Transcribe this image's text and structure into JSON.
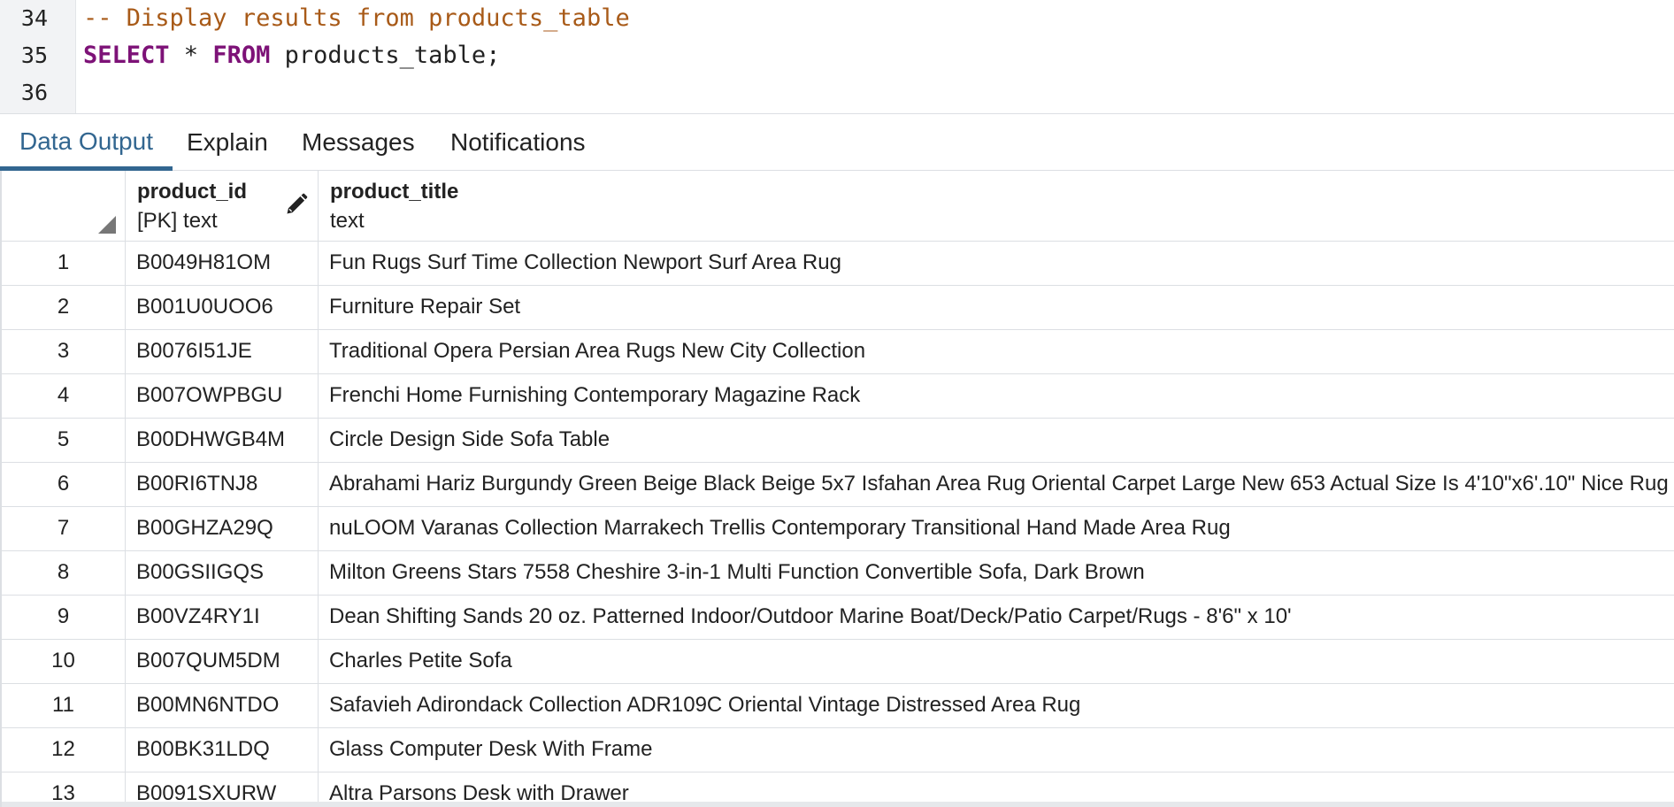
{
  "editor": {
    "lines": [
      {
        "number": "34",
        "tokens": [
          {
            "text": "-- Display results from products_table",
            "kind": "comment"
          }
        ]
      },
      {
        "number": "35",
        "tokens": [
          {
            "text": "SELECT",
            "kind": "keyword"
          },
          {
            "text": " * ",
            "kind": "plain"
          },
          {
            "text": "FROM",
            "kind": "keyword"
          },
          {
            "text": " products_table;",
            "kind": "plain"
          }
        ]
      },
      {
        "number": "36",
        "tokens": []
      }
    ]
  },
  "tabs": [
    {
      "label": "Data Output",
      "active": true
    },
    {
      "label": "Explain",
      "active": false
    },
    {
      "label": "Messages",
      "active": false
    },
    {
      "label": "Notifications",
      "active": false
    }
  ],
  "grid": {
    "columns": [
      {
        "name": "product_id",
        "type": "[PK] text",
        "icon": "pencil-icon"
      },
      {
        "name": "product_title",
        "type": "text"
      }
    ],
    "rows": [
      {
        "n": "1",
        "id": "B0049H81OM",
        "title": "Fun Rugs Surf Time Collection Newport Surf Area Rug"
      },
      {
        "n": "2",
        "id": "B001U0UOO6",
        "title": "Furniture Repair Set"
      },
      {
        "n": "3",
        "id": "B0076I51JE",
        "title": "Traditional Opera Persian Area Rugs New City Collection"
      },
      {
        "n": "4",
        "id": "B007OWPBGU",
        "title": "Frenchi Home Furnishing Contemporary  Magazine Rack"
      },
      {
        "n": "5",
        "id": "B00DHWGB4M",
        "title": "Circle Design Side Sofa Table"
      },
      {
        "n": "6",
        "id": "B00RI6TNJ8",
        "title": "Abrahami Hariz Burgundy Green Beige Black Beige 5x7 Isfahan Area Rug Oriental Carpet Large New 653 Actual Size Is 4'10\"x6'.10\" Nice Rug"
      },
      {
        "n": "7",
        "id": "B00GHZA29Q",
        "title": "nuLOOM Varanas Collection Marrakech Trellis Contemporary Transitional Hand Made Area Rug"
      },
      {
        "n": "8",
        "id": "B00GSIIGQS",
        "title": "Milton Greens Stars 7558 Cheshire 3-in-1 Multi Function Convertible Sofa, Dark Brown"
      },
      {
        "n": "9",
        "id": "B00VZ4RY1I",
        "title": "Dean Shifting Sands 20 oz. Patterned Indoor/Outdoor Marine Boat/Deck/Patio Carpet/Rugs - 8'6\" x 10'"
      },
      {
        "n": "10",
        "id": "B007QUM5DM",
        "title": "Charles Petite Sofa"
      },
      {
        "n": "11",
        "id": "B00MN6NTDO",
        "title": "Safavieh Adirondack Collection ADR109C  Oriental Vintage Distressed Area Rug"
      },
      {
        "n": "12",
        "id": "B00BK31LDQ",
        "title": "Glass Computer Desk With Frame"
      },
      {
        "n": "13",
        "id": "B0091SXURW",
        "title": "Altra Parsons Desk with Drawer"
      }
    ]
  },
  "colors": {
    "accent": "#326690",
    "comment": "#a85a18",
    "keyword": "#7d1277",
    "gutter": "#f2f3f5",
    "grid_line": "#dcdfe3"
  }
}
